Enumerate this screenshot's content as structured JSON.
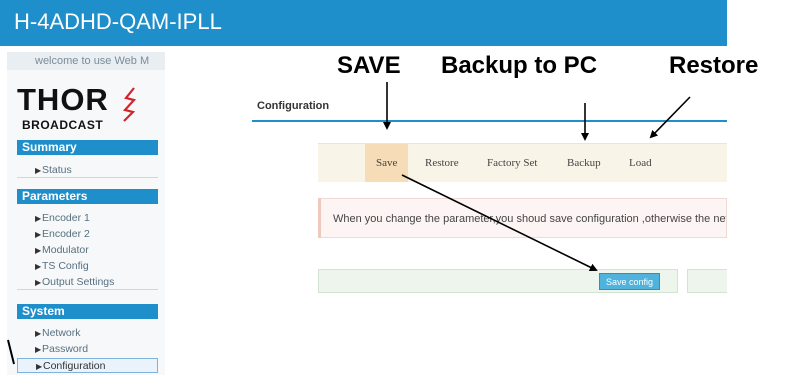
{
  "header": {
    "title": "H-4ADHD-QAM-IPLL"
  },
  "sidebar": {
    "welcome": "welcome to use Web M",
    "logo": {
      "main": "THOR",
      "sub": "BROADCAST"
    },
    "sections": [
      {
        "title": "Summary",
        "items": [
          "Status"
        ]
      },
      {
        "title": "Parameters",
        "items": [
          "Encoder 1",
          "Encoder 2",
          "Modulator",
          "TS Config",
          "Output Settings"
        ]
      },
      {
        "title": "System",
        "items": [
          "Network",
          "Password",
          "Configuration"
        ]
      }
    ]
  },
  "main": {
    "title": "Configuration",
    "tabs": [
      "Save",
      "Restore",
      "Factory Set",
      "Backup",
      "Load"
    ],
    "notice": "When you change the parameter,you shoud save configuration ,otherwise the new c",
    "save_button": "Save config"
  },
  "annotations": {
    "save": "SAVE",
    "backup": "Backup to PC",
    "restore": "Restore"
  },
  "colors": {
    "header": "#1e8fca",
    "tab_selected": "#f6ddb7",
    "button": "#4fb3de"
  }
}
